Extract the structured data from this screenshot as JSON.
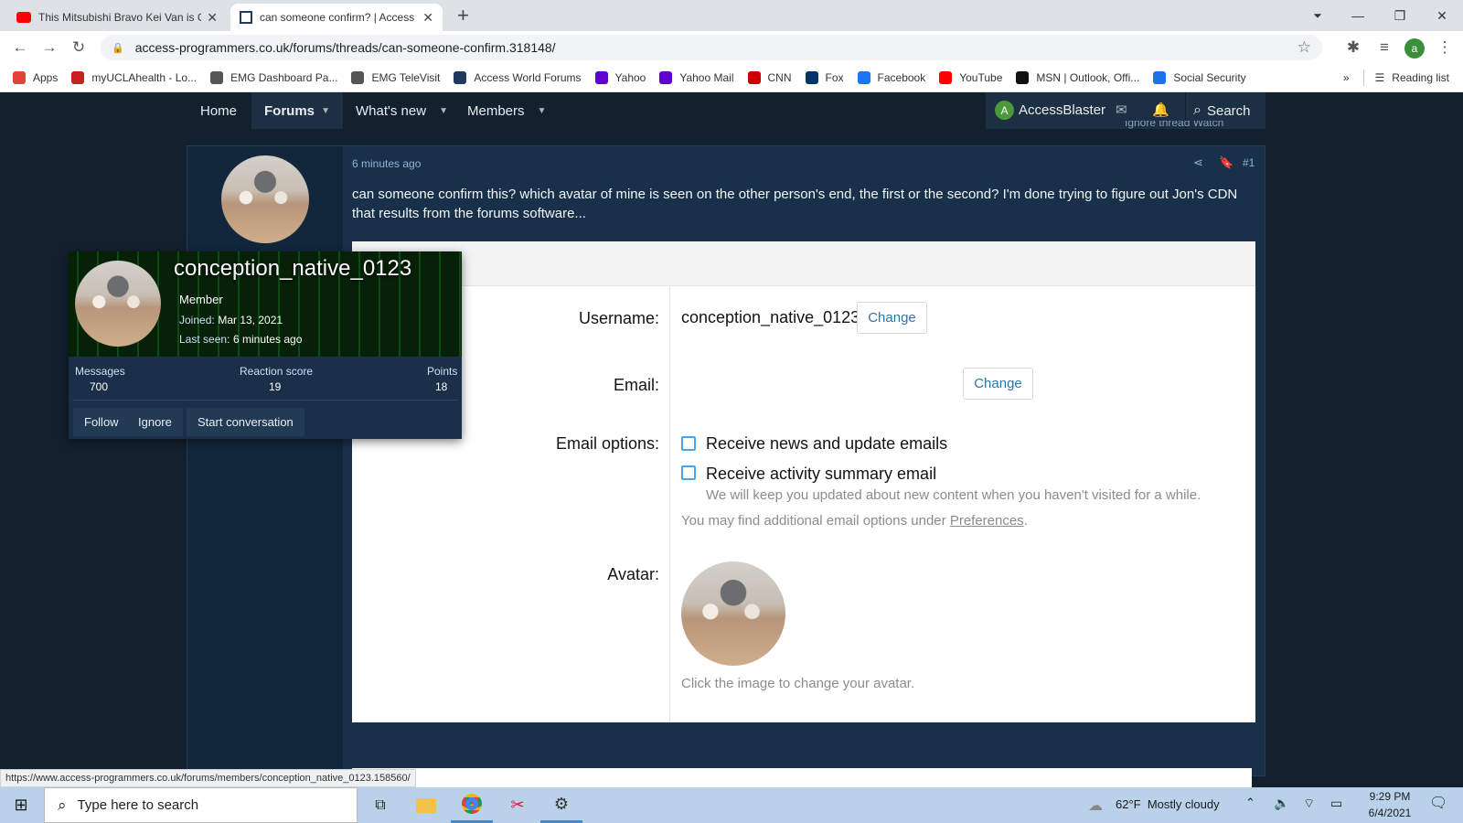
{
  "browser": {
    "tabs": [
      {
        "title": "This Mitsubishi Bravo Kei Van is C"
      },
      {
        "title": "can someone confirm? | Access W"
      }
    ],
    "url": "access-programmers.co.uk/forums/threads/can-someone-confirm.318148/",
    "profile_letter": "a",
    "bookmarks": [
      {
        "label": "Apps",
        "icon": "apps-grid-icon",
        "color": "#e04434"
      },
      {
        "label": "myUCLAhealth - Lo...",
        "icon": "heart-icon",
        "color": "#c5221f"
      },
      {
        "label": "EMG Dashboard Pa...",
        "icon": "emg-icon",
        "color": "#555555"
      },
      {
        "label": "EMG TeleVisit",
        "icon": "globe-icon",
        "color": "#555555"
      },
      {
        "label": "Access World Forums",
        "icon": "grid-icon",
        "color": "#1e3a5f"
      },
      {
        "label": "Yahoo",
        "icon": "yahoo-icon",
        "color": "#6001d2"
      },
      {
        "label": "Yahoo Mail",
        "icon": "mail-icon",
        "color": "#6001d2"
      },
      {
        "label": "CNN",
        "icon": "cnn-icon",
        "color": "#cc0000"
      },
      {
        "label": "Fox",
        "icon": "fox-icon",
        "color": "#003366"
      },
      {
        "label": "Facebook",
        "icon": "facebook-icon",
        "color": "#1877f2"
      },
      {
        "label": "YouTube",
        "icon": "youtube-icon",
        "color": "#ff0000"
      },
      {
        "label": "MSN | Outlook, Offi...",
        "icon": "msn-icon",
        "color": "#111111"
      },
      {
        "label": "Social Security",
        "icon": "ssa-icon",
        "color": "#1a73e8"
      }
    ],
    "more_bookmarks": "»",
    "reading_list": "Reading list"
  },
  "site_nav": {
    "home": "Home",
    "forums": "Forums",
    "whats_new": "What's new",
    "members": "Members",
    "user": "AccessBlaster",
    "user_initial": "A",
    "search": "Search",
    "behind_links": "Ignore thread   Watch"
  },
  "post": {
    "time": "6 minutes ago",
    "number": "#1",
    "text": "can someone confirm this? which avatar of mine is seen on the other person's end, the first or the second? I'm done trying to figure out Jon's CDN that results from the forums software...",
    "form": {
      "username_label": "Username:",
      "username_value": "conception_native_0123",
      "change": "Change",
      "email_label": "Email:",
      "email_options_label": "Email options:",
      "opt1": "Receive news and update emails",
      "opt2": "Receive activity summary email",
      "opt2_hint": "We will keep you updated about new content when you haven't visited for a while.",
      "prefs_prefix": "You may find additional email options under ",
      "prefs_link": "Preferences",
      "prefs_suffix": ".",
      "avatar_label": "Avatar:",
      "avatar_hint": "Click the image to change your avatar."
    }
  },
  "member_card": {
    "name": "conception_native_0123",
    "title": "Member",
    "joined_label": "Joined:",
    "joined": "Mar 13, 2021",
    "last_seen_label": "Last seen:",
    "last_seen": "6 minutes ago",
    "messages_label": "Messages",
    "messages": "700",
    "reaction_label": "Reaction score",
    "reaction": "19",
    "points_label": "Points",
    "points": "18",
    "follow": "Follow",
    "ignore": "Ignore",
    "start": "Start conversation"
  },
  "status_url": "https://www.access-programmers.co.uk/forums/members/conception_native_0123.158560/",
  "taskbar": {
    "search_placeholder": "Type here to search",
    "weather": "62°F  Mostly cloudy",
    "time": "9:29 PM",
    "date": "6/4/2021"
  }
}
